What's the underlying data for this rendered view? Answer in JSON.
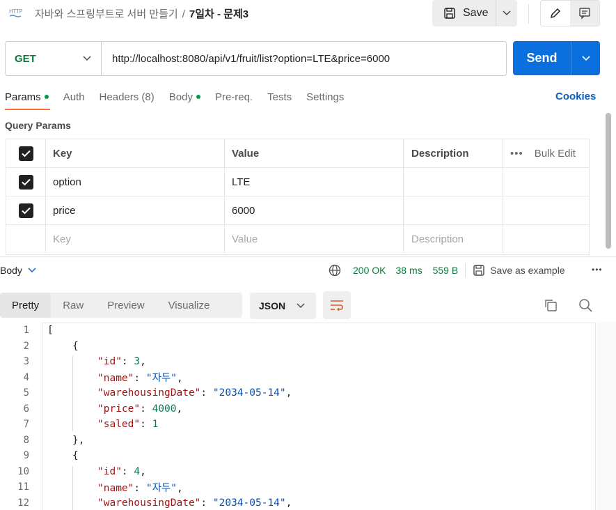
{
  "header": {
    "breadcrumb_parent": "자바와 스프링부트로 서버 만들기",
    "breadcrumb_sep": "/",
    "breadcrumb_current": "7일차 - 문제3",
    "save_label": "Save"
  },
  "request": {
    "method": "GET",
    "url": "http://localhost:8080/api/v1/fruit/list?option=LTE&price=6000",
    "send_label": "Send"
  },
  "tabs": {
    "params": "Params",
    "auth": "Auth",
    "headers": "Headers (8)",
    "body": "Body",
    "prereq": "Pre-req.",
    "tests": "Tests",
    "settings": "Settings",
    "cookies": "Cookies"
  },
  "query_params": {
    "title": "Query Params",
    "headers": {
      "key": "Key",
      "value": "Value",
      "description": "Description",
      "bulk_edit": "Bulk Edit"
    },
    "rows": [
      {
        "key": "option",
        "value": "LTE"
      },
      {
        "key": "price",
        "value": "6000"
      }
    ],
    "placeholder": {
      "key": "Key",
      "value": "Value",
      "description": "Description"
    }
  },
  "response": {
    "body_label": "Body",
    "status": "200 OK",
    "time": "38 ms",
    "size": "559 B",
    "save_example": "Save as example",
    "format_tabs": [
      "Pretty",
      "Raw",
      "Preview",
      "Visualize"
    ],
    "format": "JSON"
  },
  "code_lines": [
    {
      "n": "1",
      "text": "["
    },
    {
      "n": "2",
      "text": "{"
    },
    {
      "n": "3",
      "key": "\"id\"",
      "val": "3",
      "type": "num",
      "trail": ","
    },
    {
      "n": "4",
      "key": "\"name\"",
      "val": "\"자두\"",
      "type": "str",
      "trail": ","
    },
    {
      "n": "5",
      "key": "\"warehousingDate\"",
      "val": "\"2034-05-14\"",
      "type": "str",
      "trail": ","
    },
    {
      "n": "6",
      "key": "\"price\"",
      "val": "4000",
      "type": "num",
      "trail": ","
    },
    {
      "n": "7",
      "key": "\"saled\"",
      "val": "1",
      "type": "num",
      "trail": ""
    },
    {
      "n": "8",
      "text": "},"
    },
    {
      "n": "9",
      "text": "{"
    },
    {
      "n": "10",
      "key": "\"id\"",
      "val": "4",
      "type": "num",
      "trail": ","
    },
    {
      "n": "11",
      "key": "\"name\"",
      "val": "\"자두\"",
      "type": "str",
      "trail": ","
    },
    {
      "n": "12",
      "key": "\"warehousingDate\"",
      "val": "\"2034-05-14\"",
      "type": "str",
      "trail": ","
    }
  ]
}
